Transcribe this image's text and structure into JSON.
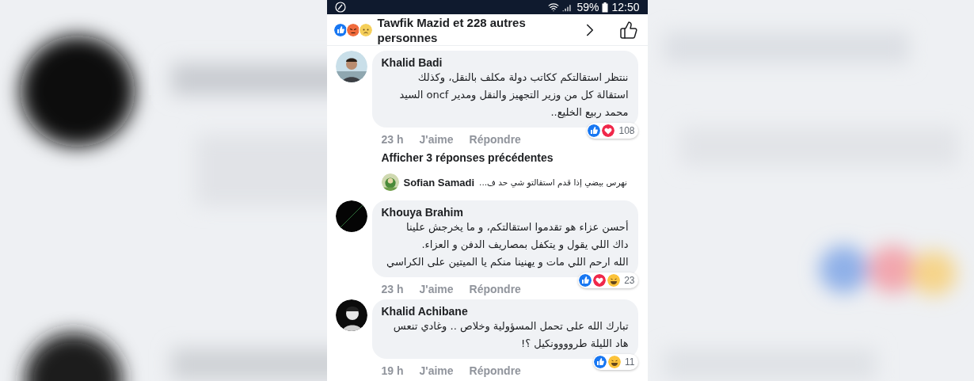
{
  "status_bar": {
    "battery": "59%",
    "time": "12:50"
  },
  "header": {
    "reactions": [
      {
        "kind": "like"
      },
      {
        "kind": "angry"
      },
      {
        "kind": "sad"
      }
    ],
    "title": "Tawfik Mazid et 228 autres personnes"
  },
  "comments": [
    {
      "author": "Khalid Badi",
      "text": "ننتظر استقالتكم ككاتب دولة مكلف بالنقل، وكذلك\nاستقالة كل من وزير التجهيز والنقل ومدير oncf السيد\nمحمد ربيع الخليع..",
      "time": "23 h",
      "like": "J'aime",
      "reply": "Répondre",
      "reactions": [
        {
          "kind": "like"
        },
        {
          "kind": "love"
        }
      ],
      "count": "108",
      "replies_link": "Afficher 3 réponses précédentes",
      "reply_preview": {
        "author": "Sofian Samadi",
        "text": "نهرس بيضي إذا قدم استقالتو شي حد ف..."
      }
    },
    {
      "author": "Khouya Brahim",
      "text": "أحسن عزاء هو تقدموا استقالتكم، و ما يخرجش علينا\nداك اللي يقول و يتكفل بمصاريف الدفن و العزاء.\nالله ارحم اللي مات و يهنينا منكم يا الميتين على الكراسي",
      "time": "23 h",
      "like": "J'aime",
      "reply": "Répondre",
      "reactions": [
        {
          "kind": "like"
        },
        {
          "kind": "love"
        },
        {
          "kind": "haha"
        }
      ],
      "count": "23"
    },
    {
      "author": "Khalid Achibane",
      "text": "تبارك الله على تحمل المسؤولية وخلاص .. وغادي تنعس\nهاد الليلة طروووونكيل ؟!",
      "time": "19 h",
      "like": "J'aime",
      "reply": "Répondre",
      "reactions": [
        {
          "kind": "like"
        },
        {
          "kind": "haha"
        }
      ],
      "count": "11"
    }
  ]
}
